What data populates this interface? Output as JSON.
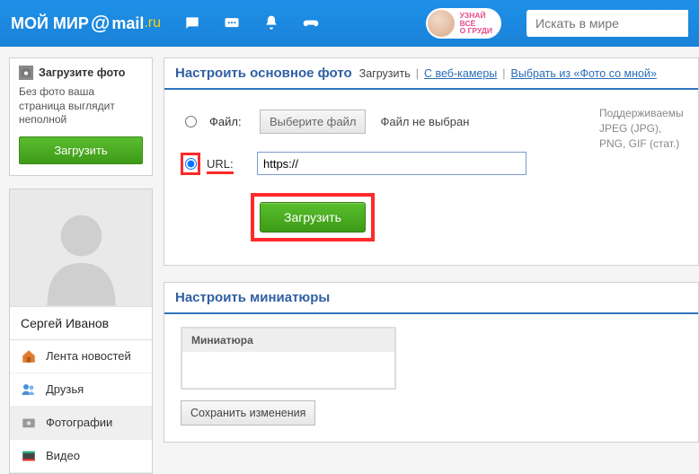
{
  "header": {
    "logo_pre": "МОЙ МИР",
    "logo_mail": "mail",
    "logo_ru": ".ru",
    "search_placeholder": "Искать в мире",
    "ad_line1": "УЗНАЙ",
    "ad_line2": "ВСЁ",
    "ad_line3": "О ГРУДИ"
  },
  "sidebar": {
    "upload": {
      "title": "Загрузите фото",
      "note": "Без фото ваша страница выглядит неполной",
      "button": "Загрузить"
    },
    "user_name": "Сергей Иванов",
    "nav": [
      {
        "label": "Лента новостей"
      },
      {
        "label": "Друзья"
      },
      {
        "label": "Фотографии"
      },
      {
        "label": "Видео"
      }
    ]
  },
  "main": {
    "photo_panel": {
      "title": "Настроить основное фото",
      "tab_upload": "Загрузить",
      "tab_webcam": "С веб-камеры",
      "tab_select": "Выбрать из «Фото со мной»",
      "label_file": "Файл:",
      "file_button": "Выберите файл",
      "file_status": "Файл не выбран",
      "label_url": "URL:",
      "url_value": "https://",
      "submit": "Загрузить",
      "support_label": "Поддерживаемы",
      "support_formats": "JPEG (JPG), PNG, GIF (стат.)"
    },
    "thumb_panel": {
      "title": "Настроить миниатюры",
      "box_title": "Миниатюра",
      "save": "Сохранить изменения"
    }
  }
}
